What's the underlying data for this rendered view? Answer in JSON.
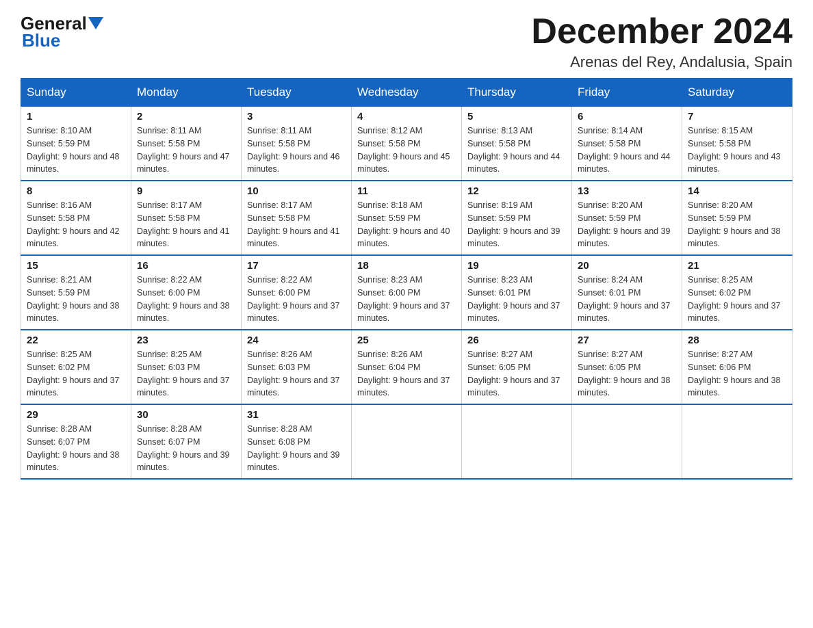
{
  "header": {
    "logo_general": "General",
    "logo_blue": "Blue",
    "month_title": "December 2024",
    "subtitle": "Arenas del Rey, Andalusia, Spain"
  },
  "weekdays": [
    "Sunday",
    "Monday",
    "Tuesday",
    "Wednesday",
    "Thursday",
    "Friday",
    "Saturday"
  ],
  "weeks": [
    [
      {
        "day": "1",
        "sunrise": "8:10 AM",
        "sunset": "5:59 PM",
        "daylight": "9 hours and 48 minutes."
      },
      {
        "day": "2",
        "sunrise": "8:11 AM",
        "sunset": "5:58 PM",
        "daylight": "9 hours and 47 minutes."
      },
      {
        "day": "3",
        "sunrise": "8:11 AM",
        "sunset": "5:58 PM",
        "daylight": "9 hours and 46 minutes."
      },
      {
        "day": "4",
        "sunrise": "8:12 AM",
        "sunset": "5:58 PM",
        "daylight": "9 hours and 45 minutes."
      },
      {
        "day": "5",
        "sunrise": "8:13 AM",
        "sunset": "5:58 PM",
        "daylight": "9 hours and 44 minutes."
      },
      {
        "day": "6",
        "sunrise": "8:14 AM",
        "sunset": "5:58 PM",
        "daylight": "9 hours and 44 minutes."
      },
      {
        "day": "7",
        "sunrise": "8:15 AM",
        "sunset": "5:58 PM",
        "daylight": "9 hours and 43 minutes."
      }
    ],
    [
      {
        "day": "8",
        "sunrise": "8:16 AM",
        "sunset": "5:58 PM",
        "daylight": "9 hours and 42 minutes."
      },
      {
        "day": "9",
        "sunrise": "8:17 AM",
        "sunset": "5:58 PM",
        "daylight": "9 hours and 41 minutes."
      },
      {
        "day": "10",
        "sunrise": "8:17 AM",
        "sunset": "5:58 PM",
        "daylight": "9 hours and 41 minutes."
      },
      {
        "day": "11",
        "sunrise": "8:18 AM",
        "sunset": "5:59 PM",
        "daylight": "9 hours and 40 minutes."
      },
      {
        "day": "12",
        "sunrise": "8:19 AM",
        "sunset": "5:59 PM",
        "daylight": "9 hours and 39 minutes."
      },
      {
        "day": "13",
        "sunrise": "8:20 AM",
        "sunset": "5:59 PM",
        "daylight": "9 hours and 39 minutes."
      },
      {
        "day": "14",
        "sunrise": "8:20 AM",
        "sunset": "5:59 PM",
        "daylight": "9 hours and 38 minutes."
      }
    ],
    [
      {
        "day": "15",
        "sunrise": "8:21 AM",
        "sunset": "5:59 PM",
        "daylight": "9 hours and 38 minutes."
      },
      {
        "day": "16",
        "sunrise": "8:22 AM",
        "sunset": "6:00 PM",
        "daylight": "9 hours and 38 minutes."
      },
      {
        "day": "17",
        "sunrise": "8:22 AM",
        "sunset": "6:00 PM",
        "daylight": "9 hours and 37 minutes."
      },
      {
        "day": "18",
        "sunrise": "8:23 AM",
        "sunset": "6:00 PM",
        "daylight": "9 hours and 37 minutes."
      },
      {
        "day": "19",
        "sunrise": "8:23 AM",
        "sunset": "6:01 PM",
        "daylight": "9 hours and 37 minutes."
      },
      {
        "day": "20",
        "sunrise": "8:24 AM",
        "sunset": "6:01 PM",
        "daylight": "9 hours and 37 minutes."
      },
      {
        "day": "21",
        "sunrise": "8:25 AM",
        "sunset": "6:02 PM",
        "daylight": "9 hours and 37 minutes."
      }
    ],
    [
      {
        "day": "22",
        "sunrise": "8:25 AM",
        "sunset": "6:02 PM",
        "daylight": "9 hours and 37 minutes."
      },
      {
        "day": "23",
        "sunrise": "8:25 AM",
        "sunset": "6:03 PM",
        "daylight": "9 hours and 37 minutes."
      },
      {
        "day": "24",
        "sunrise": "8:26 AM",
        "sunset": "6:03 PM",
        "daylight": "9 hours and 37 minutes."
      },
      {
        "day": "25",
        "sunrise": "8:26 AM",
        "sunset": "6:04 PM",
        "daylight": "9 hours and 37 minutes."
      },
      {
        "day": "26",
        "sunrise": "8:27 AM",
        "sunset": "6:05 PM",
        "daylight": "9 hours and 37 minutes."
      },
      {
        "day": "27",
        "sunrise": "8:27 AM",
        "sunset": "6:05 PM",
        "daylight": "9 hours and 38 minutes."
      },
      {
        "day": "28",
        "sunrise": "8:27 AM",
        "sunset": "6:06 PM",
        "daylight": "9 hours and 38 minutes."
      }
    ],
    [
      {
        "day": "29",
        "sunrise": "8:28 AM",
        "sunset": "6:07 PM",
        "daylight": "9 hours and 38 minutes."
      },
      {
        "day": "30",
        "sunrise": "8:28 AM",
        "sunset": "6:07 PM",
        "daylight": "9 hours and 39 minutes."
      },
      {
        "day": "31",
        "sunrise": "8:28 AM",
        "sunset": "6:08 PM",
        "daylight": "9 hours and 39 minutes."
      },
      null,
      null,
      null,
      null
    ]
  ]
}
